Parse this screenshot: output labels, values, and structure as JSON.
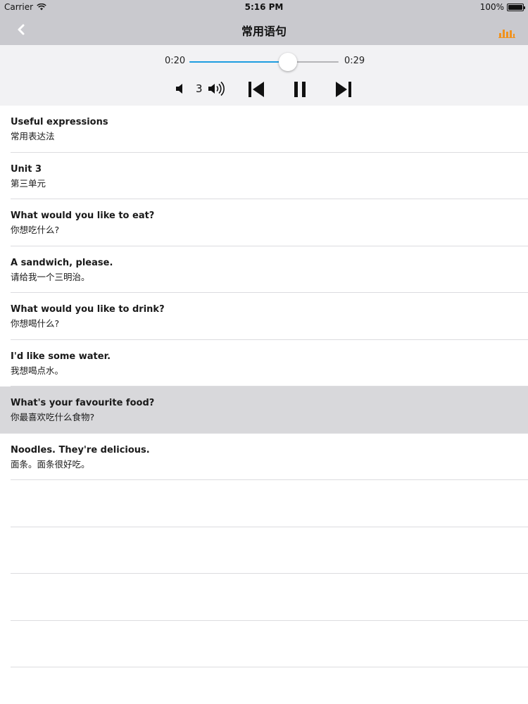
{
  "status_bar": {
    "carrier": "Carrier",
    "time": "5:16 PM",
    "battery": "100%"
  },
  "nav": {
    "title": "常用语句",
    "back_icon": "chevron-left-icon",
    "chart_icon": "bar-chart-icon",
    "accent_color": "#f0921e"
  },
  "player": {
    "current_time": "0:20",
    "total_time": "0:29",
    "progress": 0.66,
    "volume_level": "3",
    "track_color": "#1e9de0"
  },
  "list": {
    "items": [
      {
        "en": "Useful expressions",
        "zh": "常用表达法"
      },
      {
        "en": "Unit 3",
        "zh": "第三单元"
      },
      {
        "en": "What would you like to eat?",
        "zh": "你想吃什么?"
      },
      {
        "en": "A sandwich, please.",
        "zh": "请给我一个三明治。"
      },
      {
        "en": "What would you like to drink?",
        "zh": "你想喝什么?"
      },
      {
        "en": "I'd like some water.",
        "zh": "我想喝点水。"
      },
      {
        "en": "What's your favourite food?",
        "zh": "你最喜欢吃什么食物?"
      },
      {
        "en": "Noodles. They're delicious.",
        "zh": "面条。面条很好吃。"
      },
      {
        "en": "",
        "zh": ""
      },
      {
        "en": "",
        "zh": ""
      },
      {
        "en": "",
        "zh": ""
      },
      {
        "en": "",
        "zh": ""
      }
    ],
    "selected_index": 6
  }
}
